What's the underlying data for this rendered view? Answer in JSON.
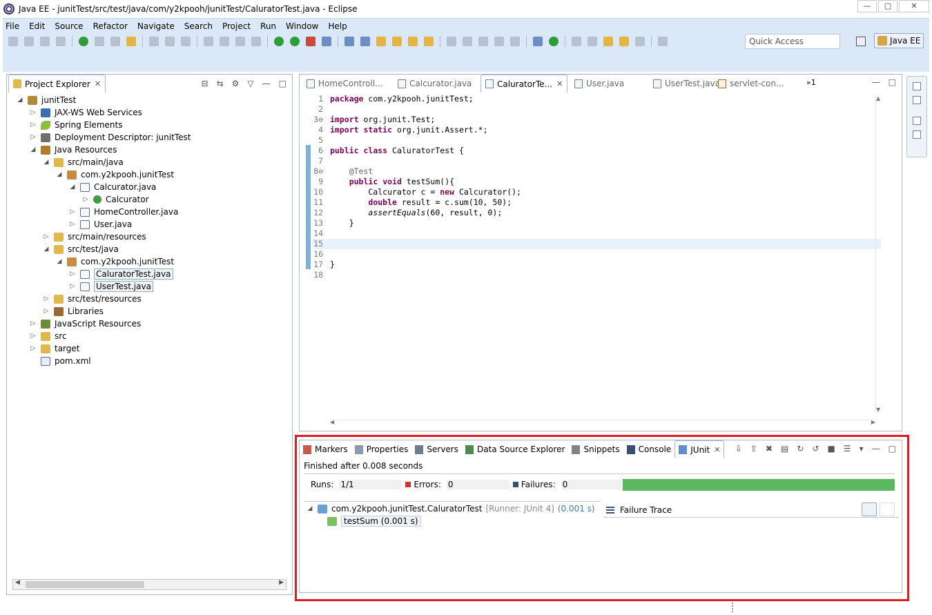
{
  "window": {
    "title": "Java EE - junitTest/src/test/java/com/y2kpooh/junitTest/CaluratorTest.java - Eclipse",
    "buttons": {
      "minimize": "—",
      "maximize": "▢",
      "close": "✕"
    }
  },
  "menu": [
    "File",
    "Edit",
    "Source",
    "Refactor",
    "Navigate",
    "Search",
    "Project",
    "Run",
    "Window",
    "Help"
  ],
  "quick_access": {
    "placeholder": "Quick Access"
  },
  "perspective": {
    "label": "Java EE"
  },
  "explorer": {
    "tab_label": "Project Explorer",
    "tree": [
      {
        "label": "junitTest",
        "indent": 0,
        "twisty": "◢",
        "icon": "project"
      },
      {
        "label": "JAX-WS Web Services",
        "indent": 1,
        "twisty": "▷",
        "icon": "ws"
      },
      {
        "label": "Spring Elements",
        "indent": 1,
        "twisty": "▷",
        "icon": "leaf"
      },
      {
        "label": "Deployment Descriptor: junitTest",
        "indent": 1,
        "twisty": "▷",
        "icon": "dd"
      },
      {
        "label": "Java Resources",
        "indent": 1,
        "twisty": "◢",
        "icon": "jr"
      },
      {
        "label": "src/main/java",
        "indent": 2,
        "twisty": "◢",
        "icon": "folder"
      },
      {
        "label": "com.y2kpooh.junitTest",
        "indent": 3,
        "twisty": "◢",
        "icon": "pkg"
      },
      {
        "label": "Calcurator.java",
        "indent": 4,
        "twisty": "◢",
        "icon": "java"
      },
      {
        "label": "Calcurator",
        "indent": 5,
        "twisty": "▷",
        "icon": "cls"
      },
      {
        "label": "HomeController.java",
        "indent": 4,
        "twisty": "▷",
        "icon": "java"
      },
      {
        "label": "User.java",
        "indent": 4,
        "twisty": "▷",
        "icon": "java"
      },
      {
        "label": "src/main/resources",
        "indent": 2,
        "twisty": "▷",
        "icon": "folder"
      },
      {
        "label": "src/test/java",
        "indent": 2,
        "twisty": "◢",
        "icon": "folder"
      },
      {
        "label": "com.y2kpooh.junitTest",
        "indent": 3,
        "twisty": "◢",
        "icon": "pkg"
      },
      {
        "label": "CaluratorTest.java",
        "indent": 4,
        "twisty": "▷",
        "icon": "java",
        "selected": true
      },
      {
        "label": "UserTest.java",
        "indent": 4,
        "twisty": "▷",
        "icon": "java",
        "selected": true
      },
      {
        "label": "src/test/resources",
        "indent": 2,
        "twisty": "▷",
        "icon": "folder"
      },
      {
        "label": "Libraries",
        "indent": 2,
        "twisty": "▷",
        "icon": "lib"
      },
      {
        "label": "JavaScript Resources",
        "indent": 1,
        "twisty": "▷",
        "icon": "js"
      },
      {
        "label": "src",
        "indent": 1,
        "twisty": "▷",
        "icon": "folder"
      },
      {
        "label": "target",
        "indent": 1,
        "twisty": "▷",
        "icon": "folder"
      },
      {
        "label": "pom.xml",
        "indent": 1,
        "twisty": "",
        "icon": "pom"
      }
    ]
  },
  "editor": {
    "tabs": [
      {
        "label": "HomeControll...",
        "active": false,
        "icon": "j"
      },
      {
        "label": "Calcurator.java",
        "active": false,
        "icon": "j"
      },
      {
        "label": "CaluratorTe...",
        "active": true,
        "icon": "j"
      },
      {
        "label": "User.java",
        "active": false,
        "icon": "j"
      },
      {
        "label": "UserTest.java",
        "active": false,
        "icon": "j"
      },
      {
        "label": "servlet-con...",
        "active": false,
        "icon": "x"
      }
    ],
    "overflow": "»1",
    "lines": [
      {
        "n": "1",
        "html": "<span class=\"kw\">package</span> com.y2kpooh.junitTest;"
      },
      {
        "n": "2",
        "html": ""
      },
      {
        "n": "3⊖",
        "html": "<span class=\"kw\">import</span> org.junit.Test;"
      },
      {
        "n": "4",
        "html": "<span class=\"kw\">import</span> <span class=\"kw\">static</span> org.junit.Assert.*;"
      },
      {
        "n": "5",
        "html": ""
      },
      {
        "n": "6",
        "html": "<span class=\"kw\">public</span> <span class=\"kw\">class</span> CaluratorTest {"
      },
      {
        "n": "7",
        "html": ""
      },
      {
        "n": "8⊖",
        "html": "    <span class=\"ann\">@Test</span>"
      },
      {
        "n": "9",
        "html": "    <span class=\"kw\">public</span> <span class=\"kw\">void</span> testSum(){"
      },
      {
        "n": "10",
        "html": "        Calcurator c = <span class=\"kw\">new</span> Calcurator();"
      },
      {
        "n": "11",
        "html": "        <span class=\"kw\">double</span> result = c.sum(10, 50);"
      },
      {
        "n": "12",
        "html": "        <span class=\"it\">assertEquals</span>(60, result, 0);"
      },
      {
        "n": "13",
        "html": "    }"
      },
      {
        "n": "14",
        "html": ""
      },
      {
        "n": "15",
        "html": "",
        "current": true
      },
      {
        "n": "16",
        "html": ""
      },
      {
        "n": "17",
        "html": "}"
      },
      {
        "n": "18",
        "html": ""
      }
    ]
  },
  "bottom": {
    "tabs": [
      {
        "label": "Markers",
        "icon": "mk"
      },
      {
        "label": "Properties",
        "icon": "pr"
      },
      {
        "label": "Servers",
        "icon": "sv"
      },
      {
        "label": "Data Source Explorer",
        "icon": "ds"
      },
      {
        "label": "Snippets",
        "icon": "sn"
      },
      {
        "label": "Console",
        "icon": "co"
      },
      {
        "label": "JUnit",
        "icon": "ju",
        "active": true
      }
    ],
    "junit": {
      "status": "Finished after 0.008 seconds",
      "runs_label": "Runs:",
      "runs_value": "1/1",
      "errors_label": "Errors:",
      "errors_value": "0",
      "failures_label": "Failures:",
      "failures_value": "0",
      "progress": 1.0,
      "progress_color": "#5cb85c",
      "suite_name": "com.y2kpooh.junitTest.CaluratorTest",
      "suite_runner": "[Runner: JUnit 4]",
      "suite_time": "(0.001 s)",
      "test_name": "testSum (0.001 s)",
      "failure_trace_label": "Failure Trace"
    }
  },
  "colors": {
    "accent_highlight": "#e01b23",
    "chrome": "#dbe8f7",
    "keyword": "#7f0055"
  }
}
